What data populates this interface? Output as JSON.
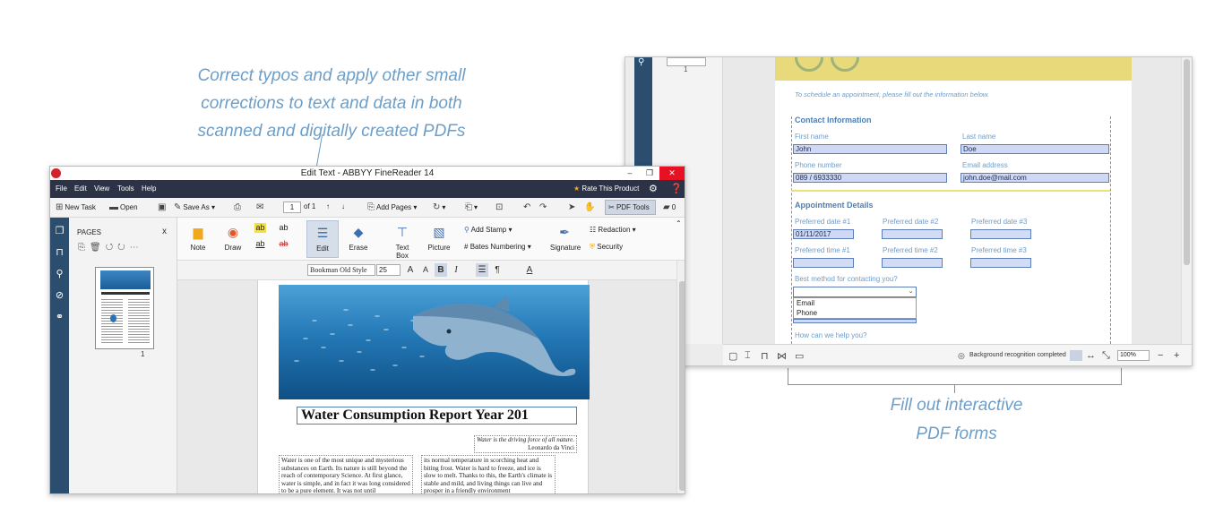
{
  "captions": {
    "left_lines": [
      "Correct typos and apply other small",
      "corrections to text and data in both",
      "scanned and digitally created PDFs"
    ],
    "right_lines": [
      "Fill out interactive",
      "PDF forms"
    ]
  },
  "colors": {
    "caption": "#6d9ec8",
    "menubar": "#2c3347",
    "sidebar": "#2b4e6f",
    "form_field": "#cfd9f5",
    "form_accent": "#e8da7a"
  },
  "form_window": {
    "thumb_page_num": "1",
    "intro": "To schedule an appointment, please fill out the information below.",
    "contact_section": "Contact Information",
    "first_name_label": "First name",
    "first_name_value": "John",
    "last_name_label": "Last name",
    "last_name_value": "Doe",
    "phone_label": "Phone number",
    "phone_value": "089 / 6933330",
    "email_label": "Email address",
    "email_value": "john.doe@mail.com",
    "appointment_section": "Appointment Details",
    "date1_label": "Preferred date #1",
    "date1_value": "01/11/2017",
    "date2_label": "Preferred date #2",
    "date3_label": "Preferred date #3",
    "time1_label": "Preferred time #1",
    "time2_label": "Preferred time #2",
    "time3_label": "Preferred time #3",
    "contact_method_label": "Best method for contacting you?",
    "contact_options": [
      "Email",
      "Phone"
    ],
    "help_label": "How can we help you?",
    "status_text": "Background recognition completed",
    "zoom": "100%"
  },
  "editor_window": {
    "title": "Edit Text - ABBYY FineReader 14",
    "menu": [
      "File",
      "Edit",
      "View",
      "Tools",
      "Help"
    ],
    "rate": "Rate This Product",
    "toolbar": {
      "new_task": "New Task",
      "open": "Open",
      "save_as": "Save As",
      "page_current": "1",
      "page_of": "of 1",
      "add_pages": "Add Pages",
      "pdf_tools": "PDF Tools",
      "comments_count": "0"
    },
    "pages_panel": {
      "title": "PAGES",
      "close": "x",
      "page_num": "1"
    },
    "ribbon": {
      "note": "Note",
      "draw": "Draw",
      "edit": "Edit",
      "erase": "Erase",
      "text_box": "Text Box",
      "picture": "Picture",
      "add_stamp": "Add Stamp",
      "bates_numbering": "Bates Numbering",
      "signature": "Signature",
      "redaction": "Redaction",
      "security": "Security",
      "hl1": "ab",
      "hl2": "ab",
      "hl3": "ab",
      "hl4": "ab"
    },
    "format_bar": {
      "font": "Bookman Old Style",
      "size": "25"
    },
    "document": {
      "title": "Water Consumption Report Year 201",
      "quote_line1": "Water is the driving force of all nature.",
      "quote_line2": "Leonardo da Vinci",
      "col1": "Water is one of the most unique and mysterious substances on Earth. Its nature is still beyond the reach of contemporary Science. At first glance, water is simple, and in fact it was long considered to be a pure element. It was not until",
      "col2": "its normal temperature in scorching heat and biting frost. Water is hard to freeze, and ice is slow to melt. Thanks to this, the Earth's climate is stable and mild, and living things can live and prosper in a friendly environment"
    }
  }
}
